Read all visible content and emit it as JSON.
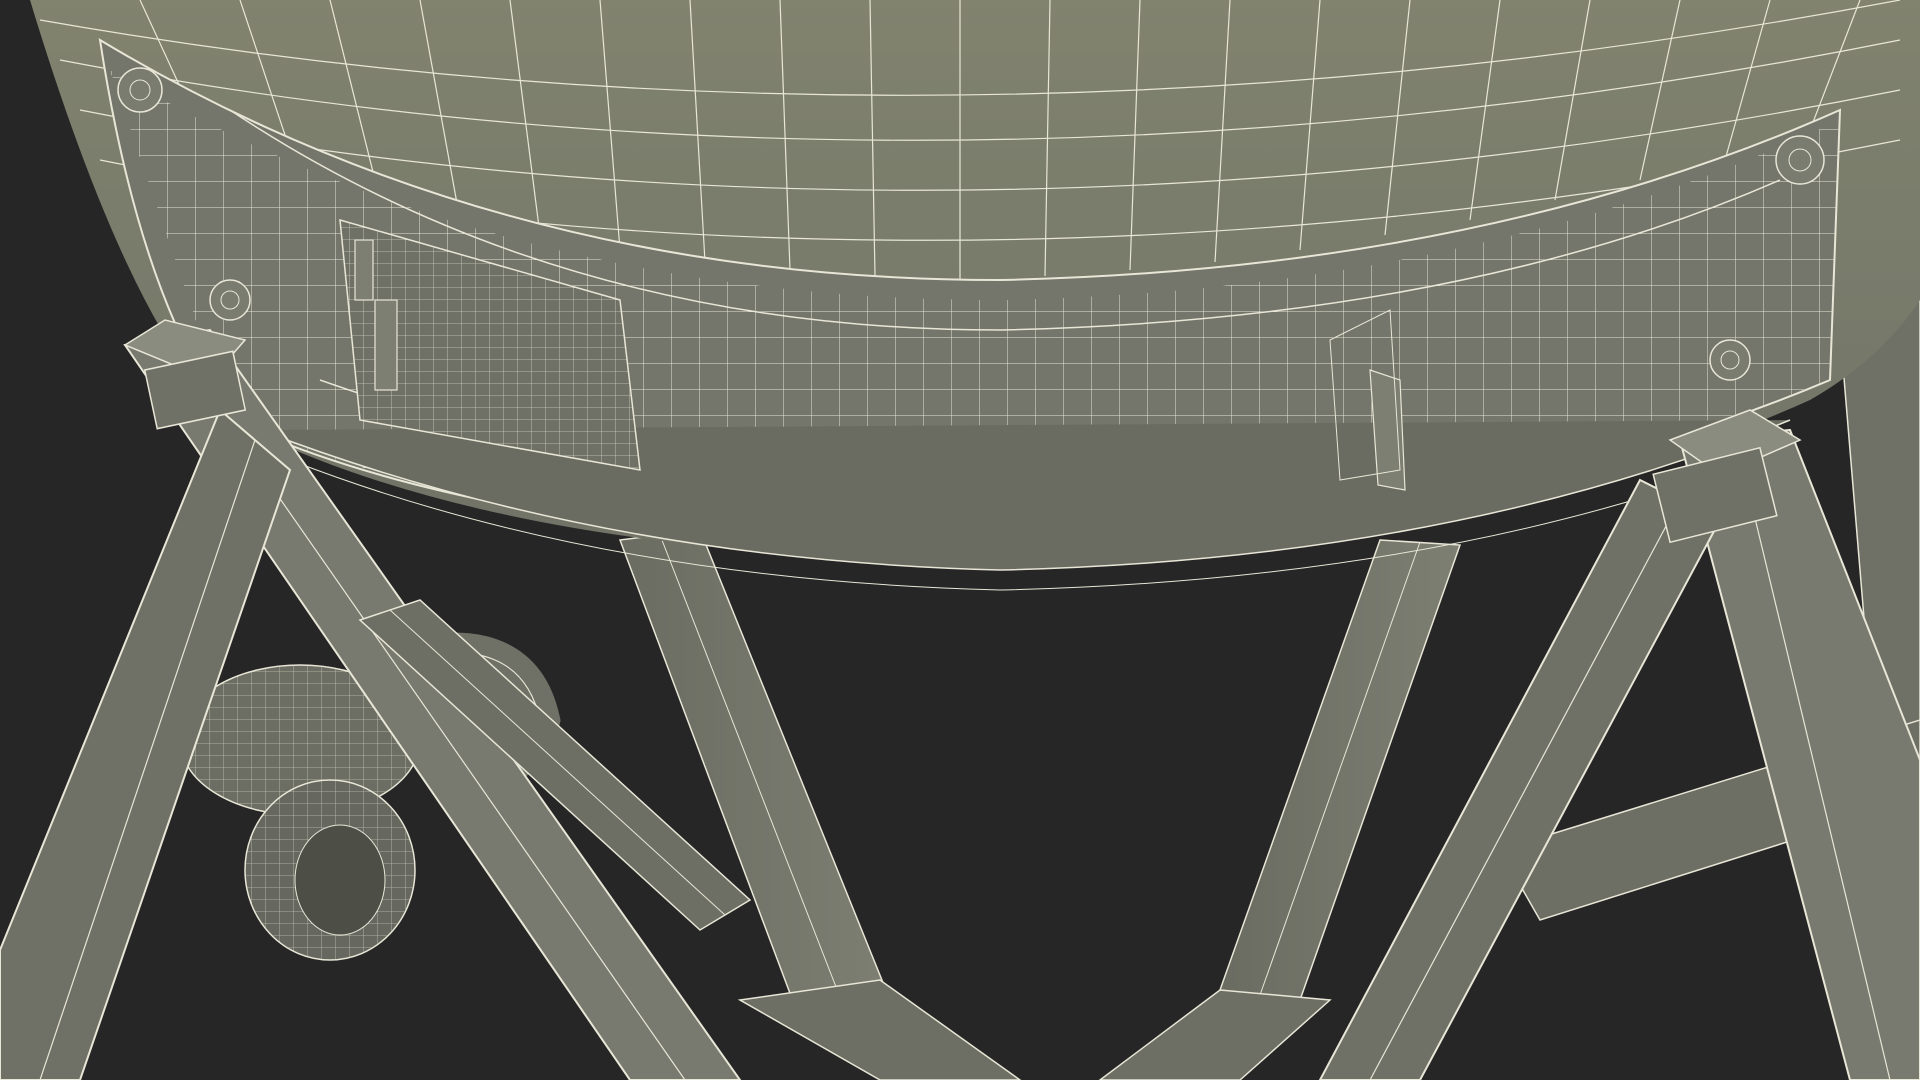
{
  "viewport": {
    "background_color": "#262626",
    "model_fill_color": "#787a6f",
    "model_shade_color": "#5b5d53",
    "wire_color": "#e8e6d6"
  }
}
